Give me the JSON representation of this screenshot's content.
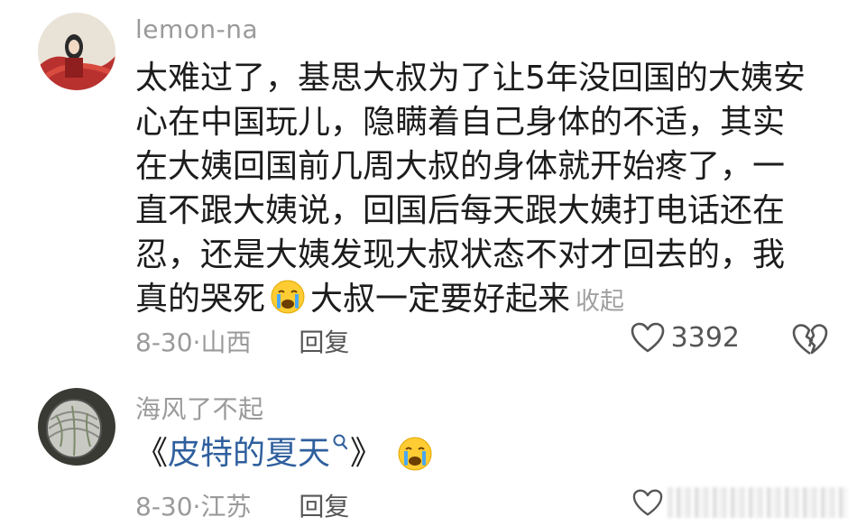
{
  "comments": [
    {
      "username": "lemon-na",
      "text_lines": [
        "太难过了，基思大叔为了让5年没回国的大姨安",
        "心在中国玩儿，隐瞒着自己身体的不适，其实",
        "在大姨回国前几周大叔的身体就开始疼了，一",
        "直不跟大姨说，回国后每天跟大姨打电话还在",
        "忍，还是大姨发现大叔状态不对才回去的，我"
      ],
      "last_line_before_emoji": "真的哭死",
      "last_line_after_emoji": "大叔一定要好起来",
      "emoji": "crying-face-emoji",
      "collapse_label": "收起",
      "date": "8-30",
      "separator": "·",
      "location": "山西",
      "reply_label": "回复",
      "like_count": "3392",
      "icons": [
        "heart-icon",
        "broken-heart-icon"
      ]
    },
    {
      "username": "海风了不起",
      "book_open": "《",
      "book_title": "皮特的夏天",
      "book_close": "》",
      "emoji": "crying-face-emoji",
      "date": "8-30",
      "separator": "·",
      "location": "江苏",
      "reply_label": "回复",
      "icons": [
        "heart-icon"
      ]
    }
  ],
  "colors": {
    "meta_gray": "#9a9a9a",
    "link_blue": "#2f5f9e",
    "text_dark": "#1c1c1c"
  }
}
